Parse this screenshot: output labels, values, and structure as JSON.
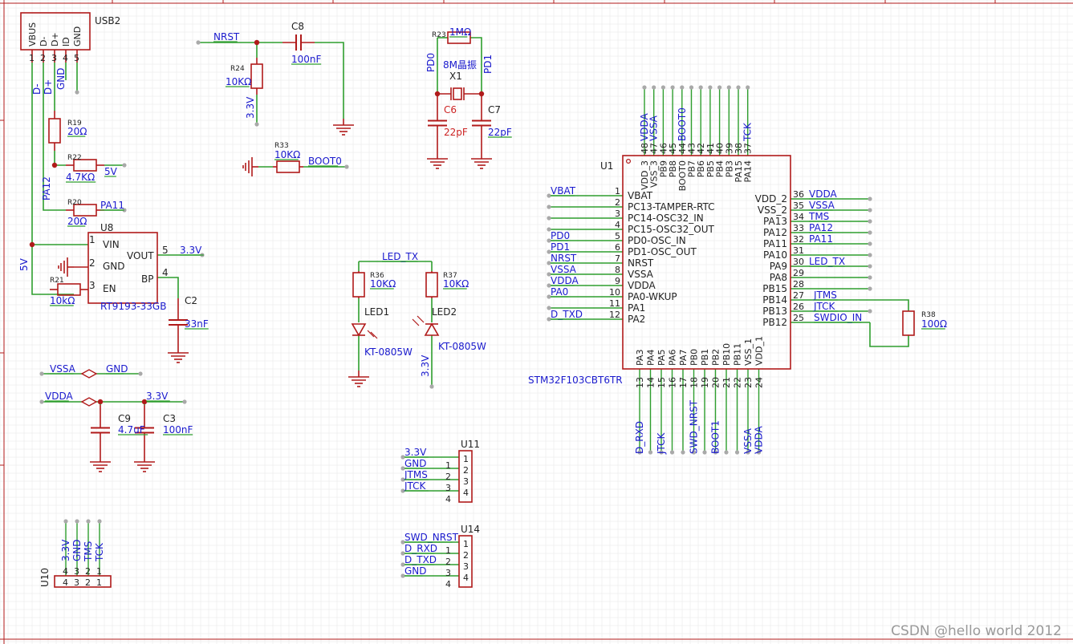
{
  "watermark": "CSDN @hello world 2012",
  "usb2": {
    "ref": "USB2",
    "pins": [
      "VBUS",
      "D-",
      "D+",
      "ID",
      "GND"
    ],
    "pin_numbers": [
      "1",
      "2",
      "3",
      "4",
      "5"
    ],
    "nets": [
      "D-",
      "D+",
      "GND"
    ]
  },
  "r19": {
    "ref": "R19",
    "value": "20Ω"
  },
  "r22": {
    "ref": "R22",
    "value": "4.7KΩ",
    "net": "5V"
  },
  "r20": {
    "ref": "R20",
    "value": "20Ω",
    "net": "PA11"
  },
  "pa12": "PA12",
  "u8": {
    "ref": "U8",
    "part": "RT9193-33GB",
    "pins": [
      "VIN",
      "GND",
      "EN",
      "VOUT",
      "BP"
    ],
    "pin_numbers": [
      "1",
      "2",
      "3",
      "5",
      "4"
    ],
    "out_net": "3.3V",
    "in_net": "5V"
  },
  "r21": {
    "ref": "R21",
    "value": "10kΩ"
  },
  "c2": {
    "ref": "C2",
    "value": "33nF"
  },
  "nrst_block": {
    "net": "NRST",
    "c8_ref": "C8",
    "c8_value": "100nF",
    "r24_ref": "R24",
    "r24_value": "10KΩ",
    "pull_net": "3.3V"
  },
  "boot_block": {
    "ref": "R33",
    "value": "10KΩ",
    "net": "BOOT0"
  },
  "crystal": {
    "r23_ref": "R23",
    "r23_value": "1MΩ",
    "x_ref": "X1",
    "x_value": "8M晶振",
    "left_net": "PD0",
    "right_net": "PD1",
    "c6_ref": "C6",
    "c6_value": "22pF",
    "c7_ref": "C7",
    "c7_value": "22pF"
  },
  "leds": {
    "net": "LED_TX",
    "r36_ref": "R36",
    "r36_value": "10KΩ",
    "r37_ref": "R37",
    "r37_value": "10KΩ",
    "led1_ref": "LED1",
    "led1_part": "KT-0805W",
    "led2_ref": "LED2",
    "led2_part": "KT-0805W",
    "led2_net": "3.3V"
  },
  "power_links": {
    "vssa": "VSSA",
    "gnd": "GND",
    "vdda": "VDDA",
    "v33": "3.3V",
    "c9_ref": "C9",
    "c9_value": "4.7uF",
    "c3_ref": "C3",
    "c3_value": "100nF"
  },
  "u1": {
    "ref": "U1",
    "part": "STM32F103CBT6TR",
    "left_pins": [
      {
        "num": "1",
        "name": "VBAT",
        "net": "VBAT"
      },
      {
        "num": "2",
        "name": "PC13-TAMPER-RTC",
        "net": ""
      },
      {
        "num": "3",
        "name": "PC14-OSC32_IN",
        "net": ""
      },
      {
        "num": "4",
        "name": "PC15-OSC32_OUT",
        "net": ""
      },
      {
        "num": "5",
        "name": "PD0-OSC_IN",
        "net": "PD0"
      },
      {
        "num": "6",
        "name": "PD1-OSC_OUT",
        "net": "PD1"
      },
      {
        "num": "7",
        "name": "NRST",
        "net": "NRST"
      },
      {
        "num": "8",
        "name": "VSSA",
        "net": "VSSA"
      },
      {
        "num": "9",
        "name": "VDDA",
        "net": "VDDA"
      },
      {
        "num": "10",
        "name": "PA0-WKUP",
        "net": "PA0"
      },
      {
        "num": "11",
        "name": "PA1",
        "net": ""
      },
      {
        "num": "12",
        "name": "PA2",
        "net": "D_TXD"
      }
    ],
    "right_pins": [
      {
        "num": "36",
        "name": "VDD_2",
        "net": "VDDA"
      },
      {
        "num": "35",
        "name": "VSS_2",
        "net": "VSSA"
      },
      {
        "num": "34",
        "name": "PA13",
        "net": "TMS"
      },
      {
        "num": "33",
        "name": "PA12",
        "net": "PA12"
      },
      {
        "num": "32",
        "name": "PA11",
        "net": "PA11"
      },
      {
        "num": "31",
        "name": "PA10",
        "net": ""
      },
      {
        "num": "30",
        "name": "PA9",
        "net": "LED_TX"
      },
      {
        "num": "29",
        "name": "PA8",
        "net": ""
      },
      {
        "num": "28",
        "name": "PB15",
        "net": ""
      },
      {
        "num": "27",
        "name": "PB14",
        "net": "JTMS"
      },
      {
        "num": "26",
        "name": "PB13",
        "net": "JTCK"
      },
      {
        "num": "25",
        "name": "PB12",
        "net": "SWDIO_IN"
      }
    ],
    "top_pins": [
      {
        "num": "48",
        "name": "VDD_3",
        "net": "VDDA"
      },
      {
        "num": "47",
        "name": "VSS_3",
        "net": "VSSA"
      },
      {
        "num": "46",
        "name": "PB9",
        "net": ""
      },
      {
        "num": "45",
        "name": "PB8",
        "net": ""
      },
      {
        "num": "44",
        "name": "BOOT0",
        "net": "BOOT0"
      },
      {
        "num": "43",
        "name": "PB7",
        "net": ""
      },
      {
        "num": "42",
        "name": "PB6",
        "net": ""
      },
      {
        "num": "41",
        "name": "PB5",
        "net": ""
      },
      {
        "num": "40",
        "name": "PB4",
        "net": ""
      },
      {
        "num": "39",
        "name": "PB3",
        "net": ""
      },
      {
        "num": "38",
        "name": "PA15",
        "net": ""
      },
      {
        "num": "37",
        "name": "PA14",
        "net": "TCK"
      }
    ],
    "bottom_pins": [
      {
        "num": "13",
        "name": "PA3",
        "net": "D_RXD"
      },
      {
        "num": "14",
        "name": "PA4",
        "net": ""
      },
      {
        "num": "15",
        "name": "PA5",
        "net": "JTCK"
      },
      {
        "num": "16",
        "name": "PA6",
        "net": ""
      },
      {
        "num": "17",
        "name": "PA7",
        "net": ""
      },
      {
        "num": "18",
        "name": "PB0",
        "net": "SWD_NRST"
      },
      {
        "num": "19",
        "name": "PB1",
        "net": ""
      },
      {
        "num": "20",
        "name": "PB2",
        "net": "BOOT1"
      },
      {
        "num": "21",
        "name": "PB10",
        "net": ""
      },
      {
        "num": "22",
        "name": "PB11",
        "net": ""
      },
      {
        "num": "23",
        "name": "VSS_1",
        "net": "VSSA"
      },
      {
        "num": "24",
        "name": "VDD_1",
        "net": "VDDA"
      }
    ]
  },
  "r38": {
    "ref": "R38",
    "value": "100Ω"
  },
  "u11": {
    "ref": "U11",
    "nets": [
      "3.3V",
      "GND",
      "JTMS",
      "JTCK"
    ],
    "left_nums": [
      "1",
      "2",
      "3",
      "4"
    ],
    "right_nums": [
      "1",
      "2",
      "3",
      "4"
    ]
  },
  "u14": {
    "ref": "U14",
    "nets": [
      "SWD_NRST",
      "D_RXD",
      "D_TXD",
      "GND"
    ],
    "left_nums": [
      "1",
      "2",
      "3",
      "4"
    ],
    "right_nums": [
      "1",
      "2",
      "3",
      "4"
    ]
  },
  "u10": {
    "ref": "U10",
    "nets": [
      "3.3V",
      "GND",
      "TMS",
      "TCK"
    ],
    "nums": [
      "4",
      "3",
      "2",
      "1"
    ]
  },
  "colors": {
    "wire": "#2e9e2e",
    "part": "#b01a1a",
    "net_text": "#1a1acd",
    "text": "#222222",
    "frame": "#b01a1a",
    "grid": "#e6e6e6"
  }
}
